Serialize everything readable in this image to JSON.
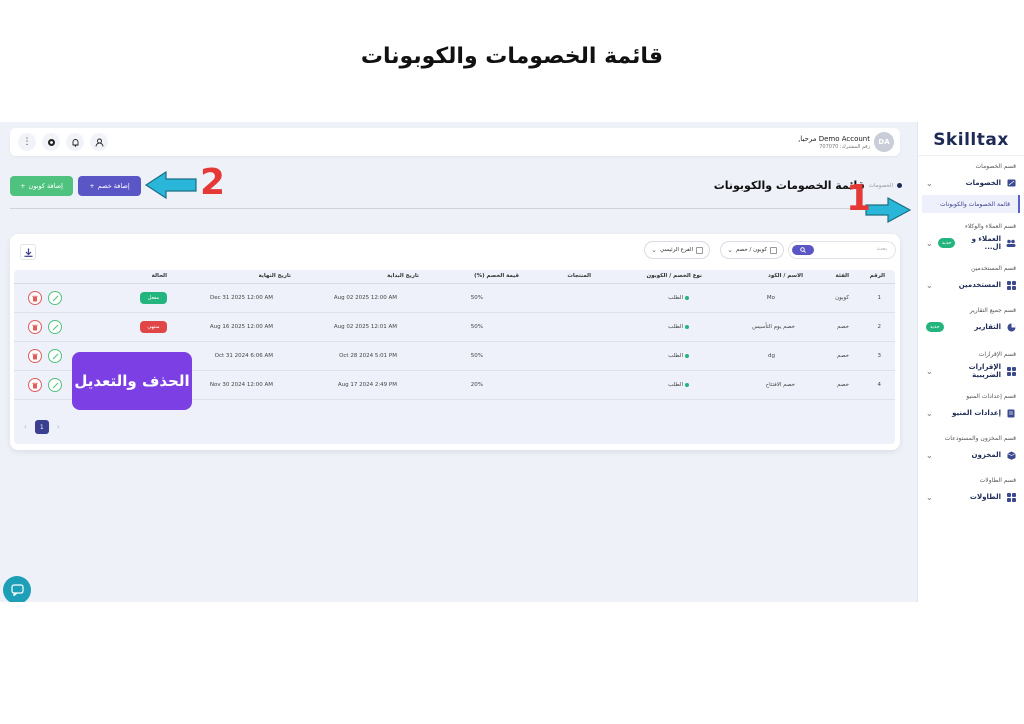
{
  "page_heading": "قائمة الخصومات والكوبونات",
  "brand": "Skilltax",
  "sidebar": {
    "sections": [
      {
        "title": "قسم الخصومات",
        "label": "الخصومات",
        "icon": "discount-icon",
        "badge": "",
        "sub": "قائمة الخصومات والكوبونات"
      },
      {
        "title": "قسم العملاء والوكلاء",
        "label": "العملاء و ال...",
        "icon": "users-icon",
        "badge": "جديد"
      },
      {
        "title": "قسم المستخدمين",
        "label": "المستخدمين",
        "icon": "grid-icon",
        "badge": ""
      },
      {
        "title": "قسم جميع التقارير",
        "label": "التقارير",
        "icon": "pie-chart-icon",
        "badge": "جديد"
      },
      {
        "title": "قسم الإقرارات",
        "label": "الإقرارات الضريبية",
        "icon": "grid-icon",
        "badge": ""
      },
      {
        "title": "قسم إعدادات المنيو",
        "label": "إعدادات المنيو",
        "icon": "document-icon",
        "badge": ""
      },
      {
        "title": "قسم المخزون والمستودعات",
        "label": "المخزون",
        "icon": "box-icon",
        "badge": ""
      },
      {
        "title": "قسم الطاولات",
        "label": "الطاولات",
        "icon": "grid-icon",
        "badge": ""
      }
    ]
  },
  "topbar": {
    "user_name": "Demo Account مرحبا,",
    "user_sub": "رقم المشترك: 707070",
    "avatar": "DA",
    "icons": [
      "more-vertical-icon",
      "settings-icon",
      "bell-icon",
      "profile-icon"
    ]
  },
  "header": {
    "title": "قائمة الخصومات والكوبونات",
    "breadcrumb": "الخصومات",
    "add_discount": "إضافة خصم",
    "add_coupon": "إضافة كوبون"
  },
  "filters": {
    "search_placeholder": "بحث",
    "type_select": "كوبون / خصم",
    "branch_select": "الفرع الرئيسي"
  },
  "table": {
    "headers": {
      "num": "الرقم",
      "category": "الفئة",
      "name_code": "الاسم / الكود",
      "type": "نوع الخصم / الكوبون",
      "products": "المنتجات",
      "value": "قيمة الخصم (%)",
      "start": "تاريخ البداية",
      "end": "تاريخ النهاية",
      "status": "الحالة"
    },
    "rows": [
      {
        "num": "1",
        "category": "كوبون",
        "name": "Mo",
        "type": "الطلب",
        "value": "50%",
        "start": "Aug 02 2025 12:00 AM",
        "end": "Dec 31 2025 12:00 AM",
        "status": "مفعل",
        "status_color": "#24b47e"
      },
      {
        "num": "2",
        "category": "خصم",
        "name": "خصم يوم التأسيس",
        "type": "الطلب",
        "value": "50%",
        "start": "Aug 02 2025 12:01 AM",
        "end": "Aug 16 2025 12:00 AM",
        "status": "منتهي",
        "status_color": "#e04646"
      },
      {
        "num": "3",
        "category": "خصم",
        "name": "dg",
        "type": "الطلب",
        "value": "50%",
        "start": "Oct 28 2024 5:01 PM",
        "end": "Oct 31 2024 6:06 AM",
        "status": "",
        "status_color": ""
      },
      {
        "num": "4",
        "category": "خصم",
        "name": "خصم الافتتاح",
        "type": "الطلب",
        "value": "20%",
        "start": "Aug 17 2024 2:49 PM",
        "end": "Nov 30 2024 12:00 AM",
        "status": "",
        "status_color": ""
      }
    ]
  },
  "pagination": {
    "current": "1"
  },
  "overlay_label": "الحذف والتعديل",
  "annotations": {
    "one": "1",
    "two": "2"
  },
  "colors": {
    "primary": "#5b56c6",
    "success": "#4fc27f",
    "danger": "#e04646",
    "annotation": "#e53935",
    "arrow": "#29b6d8",
    "overlay": "#7b3fe4"
  }
}
